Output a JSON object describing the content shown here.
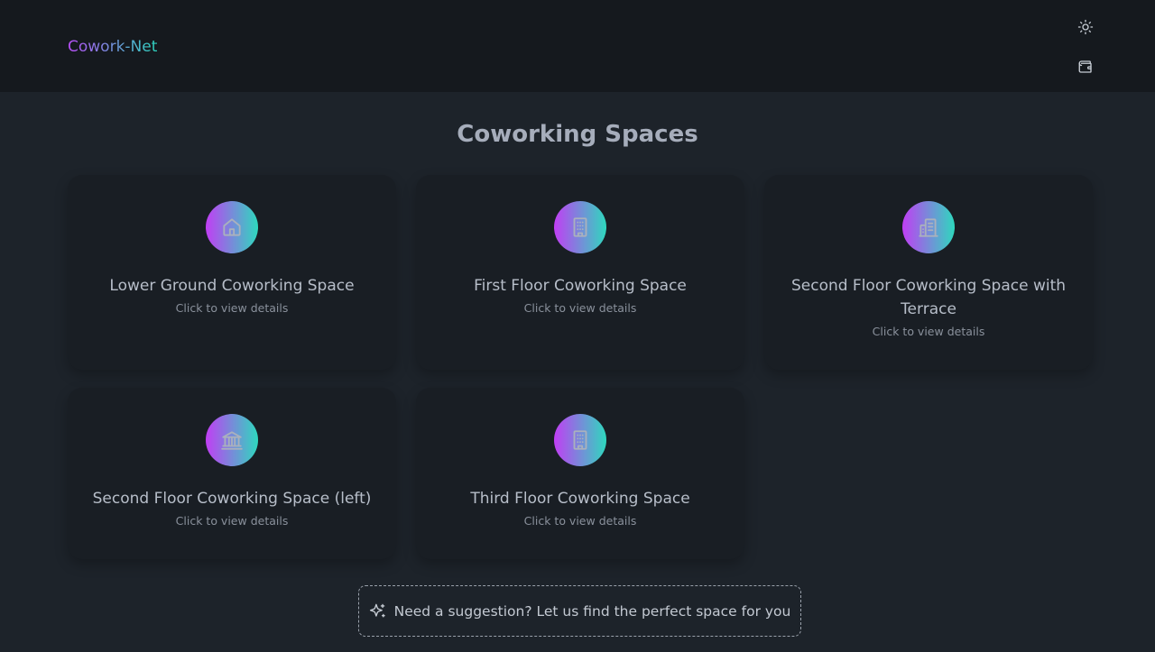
{
  "header": {
    "brand": "Cowork-Net",
    "theme_icon": "sun-icon",
    "wallet_icon": "wallet-icon"
  },
  "main": {
    "title": "Coworking Spaces",
    "cards": [
      {
        "title": "Lower Ground Coworking Space",
        "subtitle": "Click to view details",
        "icon": "home-icon"
      },
      {
        "title": "First Floor Coworking Space",
        "subtitle": "Click to view details",
        "icon": "building-icon"
      },
      {
        "title": "Second Floor Coworking Space with Terrace",
        "subtitle": "Click to view details",
        "icon": "buildings-icon"
      },
      {
        "title": "Second Floor Coworking Space (left)",
        "subtitle": "Click to view details",
        "icon": "landmark-icon"
      },
      {
        "title": "Third Floor Coworking Space",
        "subtitle": "Click to view details",
        "icon": "building-icon"
      }
    ]
  },
  "suggestion": {
    "label": "Need a suggestion? Let us find the perfect space for you",
    "icon": "sparkles-icon"
  },
  "colors": {
    "background": "#1d232a",
    "header": "#15191e",
    "card": "#191e24",
    "gradient_start": "#c13ef4",
    "gradient_end": "#2ed8be"
  }
}
